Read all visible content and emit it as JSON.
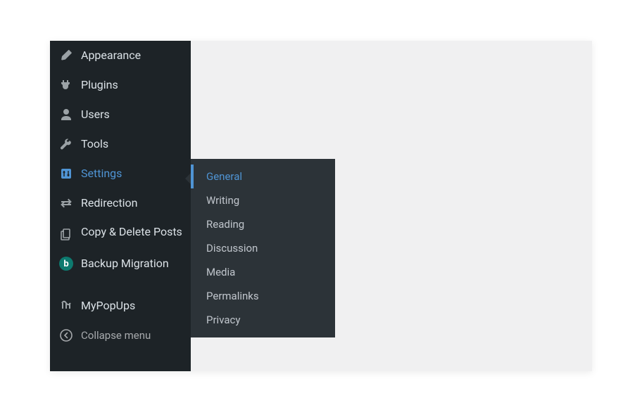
{
  "sidebar": {
    "items": {
      "appearance": "Appearance",
      "plugins": "Plugins",
      "users": "Users",
      "tools": "Tools",
      "settings": "Settings",
      "redirection": "Redirection",
      "copy_delete_posts": "Copy & Delete Posts",
      "backup_migration": "Backup Migration",
      "mypopups": "MyPopUps"
    },
    "collapse": "Collapse menu"
  },
  "submenu": {
    "general": "General",
    "writing": "Writing",
    "reading": "Reading",
    "discussion": "Discussion",
    "media": "Media",
    "permalinks": "Permalinks",
    "privacy": "Privacy"
  },
  "colors": {
    "sidebar_bg": "#1d2327",
    "submenu_bg": "#2c3338",
    "active": "#4f94d4"
  }
}
